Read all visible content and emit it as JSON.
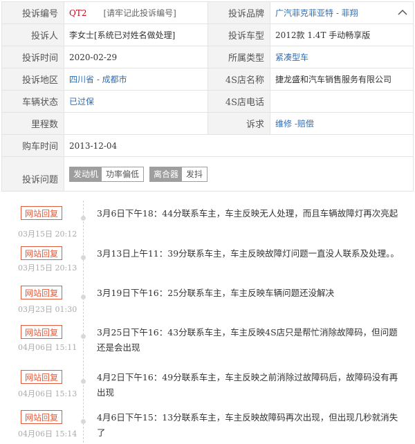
{
  "complaint": {
    "rows": [
      {
        "l1": "投诉编号",
        "v1": "QT2",
        "v1b": "[请牢记此投诉编号]",
        "l2": "投诉品牌",
        "v2": "广汽菲克菲亚特 - 菲翔"
      },
      {
        "l1": "投诉人",
        "v1": "李女士[系统已对姓名做处理]",
        "l2": "投诉车型",
        "v2": "2012款 1.4T 手动畅享版"
      },
      {
        "l1": "投诉时间",
        "v1": "2020-02-29",
        "l2": "所属类型",
        "v2": "紧凑型车"
      },
      {
        "l1": "投诉地区",
        "v1": "四川省 - 成都市",
        "l2": "4S店名称",
        "v2": "捷龙盛和汽车销售服务有限公司"
      },
      {
        "l1": "车辆状态",
        "v1": "已过保",
        "l2": "4S店电话",
        "v2": ""
      },
      {
        "l1": "里程数",
        "v1": "",
        "l2": "诉求",
        "v2": "维修 -赔偿"
      },
      {
        "l1": "购车时间",
        "v1": "2013-12-04"
      }
    ],
    "issue_label": "投诉问题",
    "issue_tags": [
      {
        "main": "发动机",
        "sub": "功率偏低"
      },
      {
        "main": "离合器",
        "sub": "发抖"
      }
    ]
  },
  "timeline": [
    {
      "badge": "网站回复",
      "time": "03月15日 20:12",
      "text": "3月6日下午18：44分联系车主，车主反映无人处理，而且车辆故障灯再次亮起"
    },
    {
      "badge": "网站回复",
      "time": "03月15日 20:13",
      "text": "3月13日上午11：39分联系车主，车主反映故障灯问题一直没人联系及处理。。"
    },
    {
      "badge": "网站回复",
      "time": "03月23日 01:30",
      "text": "3月19日下午16：25分联系车主，车主反映车辆问题还没解决"
    },
    {
      "badge": "网站回复",
      "time": "04月06日 15:11",
      "text": "3月25日下午16：43分联系车主，车主反映4S店只是帮忙消除故障码，但问题还是会出现"
    },
    {
      "badge": "网站回复",
      "time": "04月06日 15:13",
      "text": "4月2日下午16：49分联系车主，车主反映之前消除过故障码后，故障码没有再出现"
    },
    {
      "badge": "网站回复",
      "time": "04月06日 15:14",
      "text": "4月6日下午15：13分联系车主，车主反映故障码再次出现，但出现几秒就消失了"
    }
  ]
}
